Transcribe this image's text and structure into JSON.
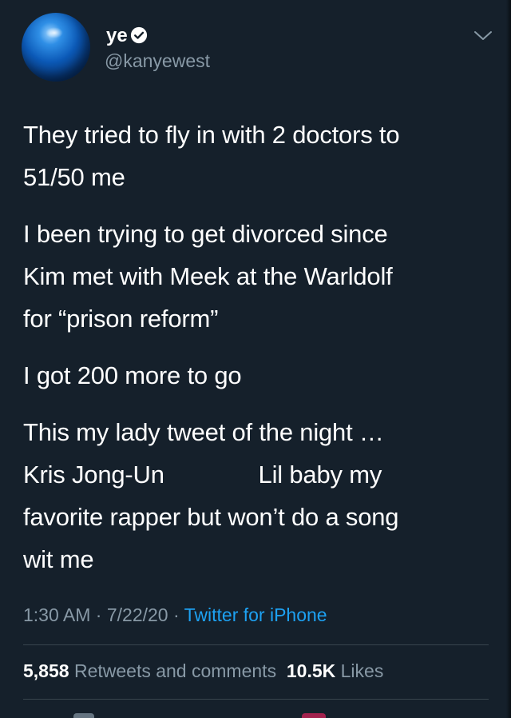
{
  "user": {
    "display_name": "ye",
    "handle": "@kanyewest",
    "verified": true
  },
  "tweet": {
    "paragraphs": [
      [
        "They tried to fly in with 2 doctors to",
        "51/50 me"
      ],
      [
        "I been trying to get divorced since",
        "Kim met with Meek at the Warldolf",
        "for “prison reform”"
      ],
      [
        "I got 200 more to go"
      ],
      [
        "This my lady tweet of the night …",
        "Kris Jong-Un              Lil baby my",
        "favorite rapper but won’t do a song",
        "wit me"
      ]
    ]
  },
  "meta": {
    "time": "1:30 AM",
    "separator": " · ",
    "date": "7/22/20",
    "source": "Twitter for iPhone"
  },
  "stats": {
    "retweets_count": "5,858",
    "retweets_label": "Retweets and comments",
    "likes_count": "10.5K",
    "likes_label": "Likes"
  },
  "colors": {
    "background": "#15202b",
    "text_primary": "#ffffff",
    "text_secondary": "#8899a6",
    "accent": "#1da1f2",
    "divider": "#38444d"
  },
  "icons": {
    "verified": "verified-badge-icon",
    "menu": "chevron-down-icon"
  }
}
